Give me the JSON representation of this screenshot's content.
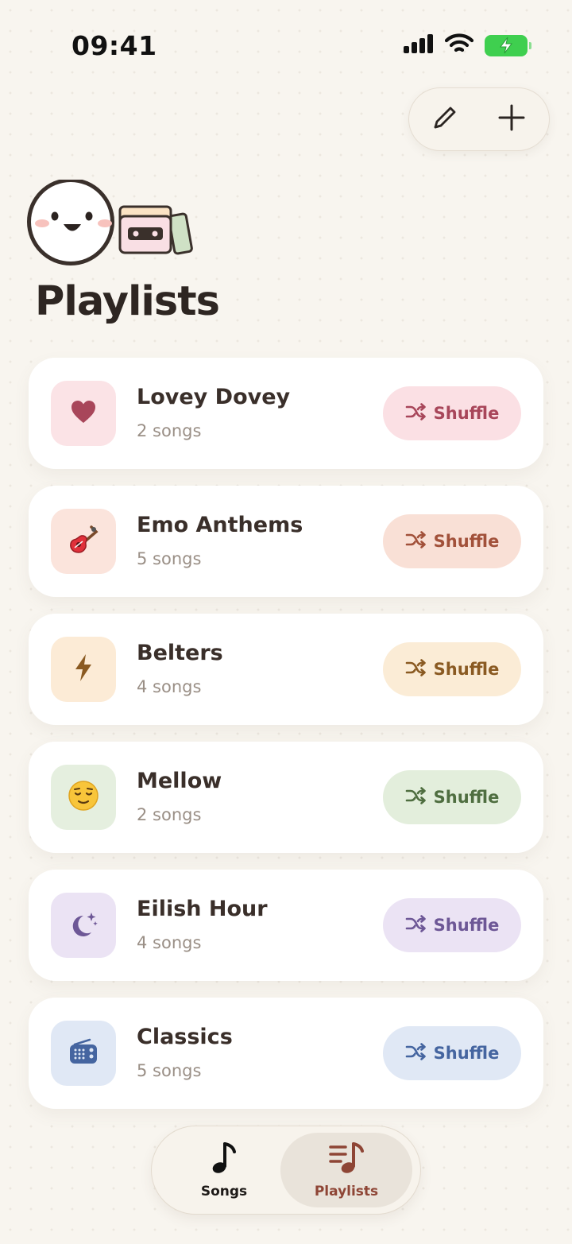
{
  "status": {
    "time": "09:41"
  },
  "header": {
    "title": "Playlists",
    "actions": [
      {
        "name": "edit",
        "icon": "pencil-icon"
      },
      {
        "name": "add",
        "icon": "plus-icon"
      }
    ]
  },
  "playlists": [
    {
      "name": "Lovey Dovey",
      "count": "2 songs",
      "icon": "heart-icon",
      "thumb_bg": "#fbe3e6",
      "accent": "#a8465a",
      "btn_bg": "#fbe0e4",
      "shuffle_label": "Shuffle"
    },
    {
      "name": "Emo Anthems",
      "count": "5 songs",
      "icon": "guitar-icon",
      "thumb_bg": "#fbe4dc",
      "accent": "#a2513a",
      "btn_bg": "#f9e0d6",
      "shuffle_label": "Shuffle"
    },
    {
      "name": "Belters",
      "count": "4 songs",
      "icon": "lightning-icon",
      "thumb_bg": "#fcebd6",
      "accent": "#8a5a22",
      "btn_bg": "#fbecd6",
      "shuffle_label": "Shuffle"
    },
    {
      "name": "Mellow",
      "count": "2 songs",
      "icon": "relieved-face-icon",
      "thumb_bg": "#e5efdf",
      "accent": "#4f6e40",
      "btn_bg": "#e3eedc",
      "shuffle_label": "Shuffle"
    },
    {
      "name": "Eilish Hour",
      "count": "4 songs",
      "icon": "moon-stars-icon",
      "thumb_bg": "#ebe3f4",
      "accent": "#6d5796",
      "btn_bg": "#ebe3f4",
      "shuffle_label": "Shuffle"
    },
    {
      "name": "Classics",
      "count": "5 songs",
      "icon": "radio-icon",
      "thumb_bg": "#e0e8f5",
      "accent": "#4565a0",
      "btn_bg": "#e0e8f5",
      "shuffle_label": "Shuffle"
    }
  ],
  "tabs": [
    {
      "label": "Songs",
      "icon": "music-note-icon",
      "active": false
    },
    {
      "label": "Playlists",
      "icon": "playlist-icon",
      "active": true
    }
  ]
}
